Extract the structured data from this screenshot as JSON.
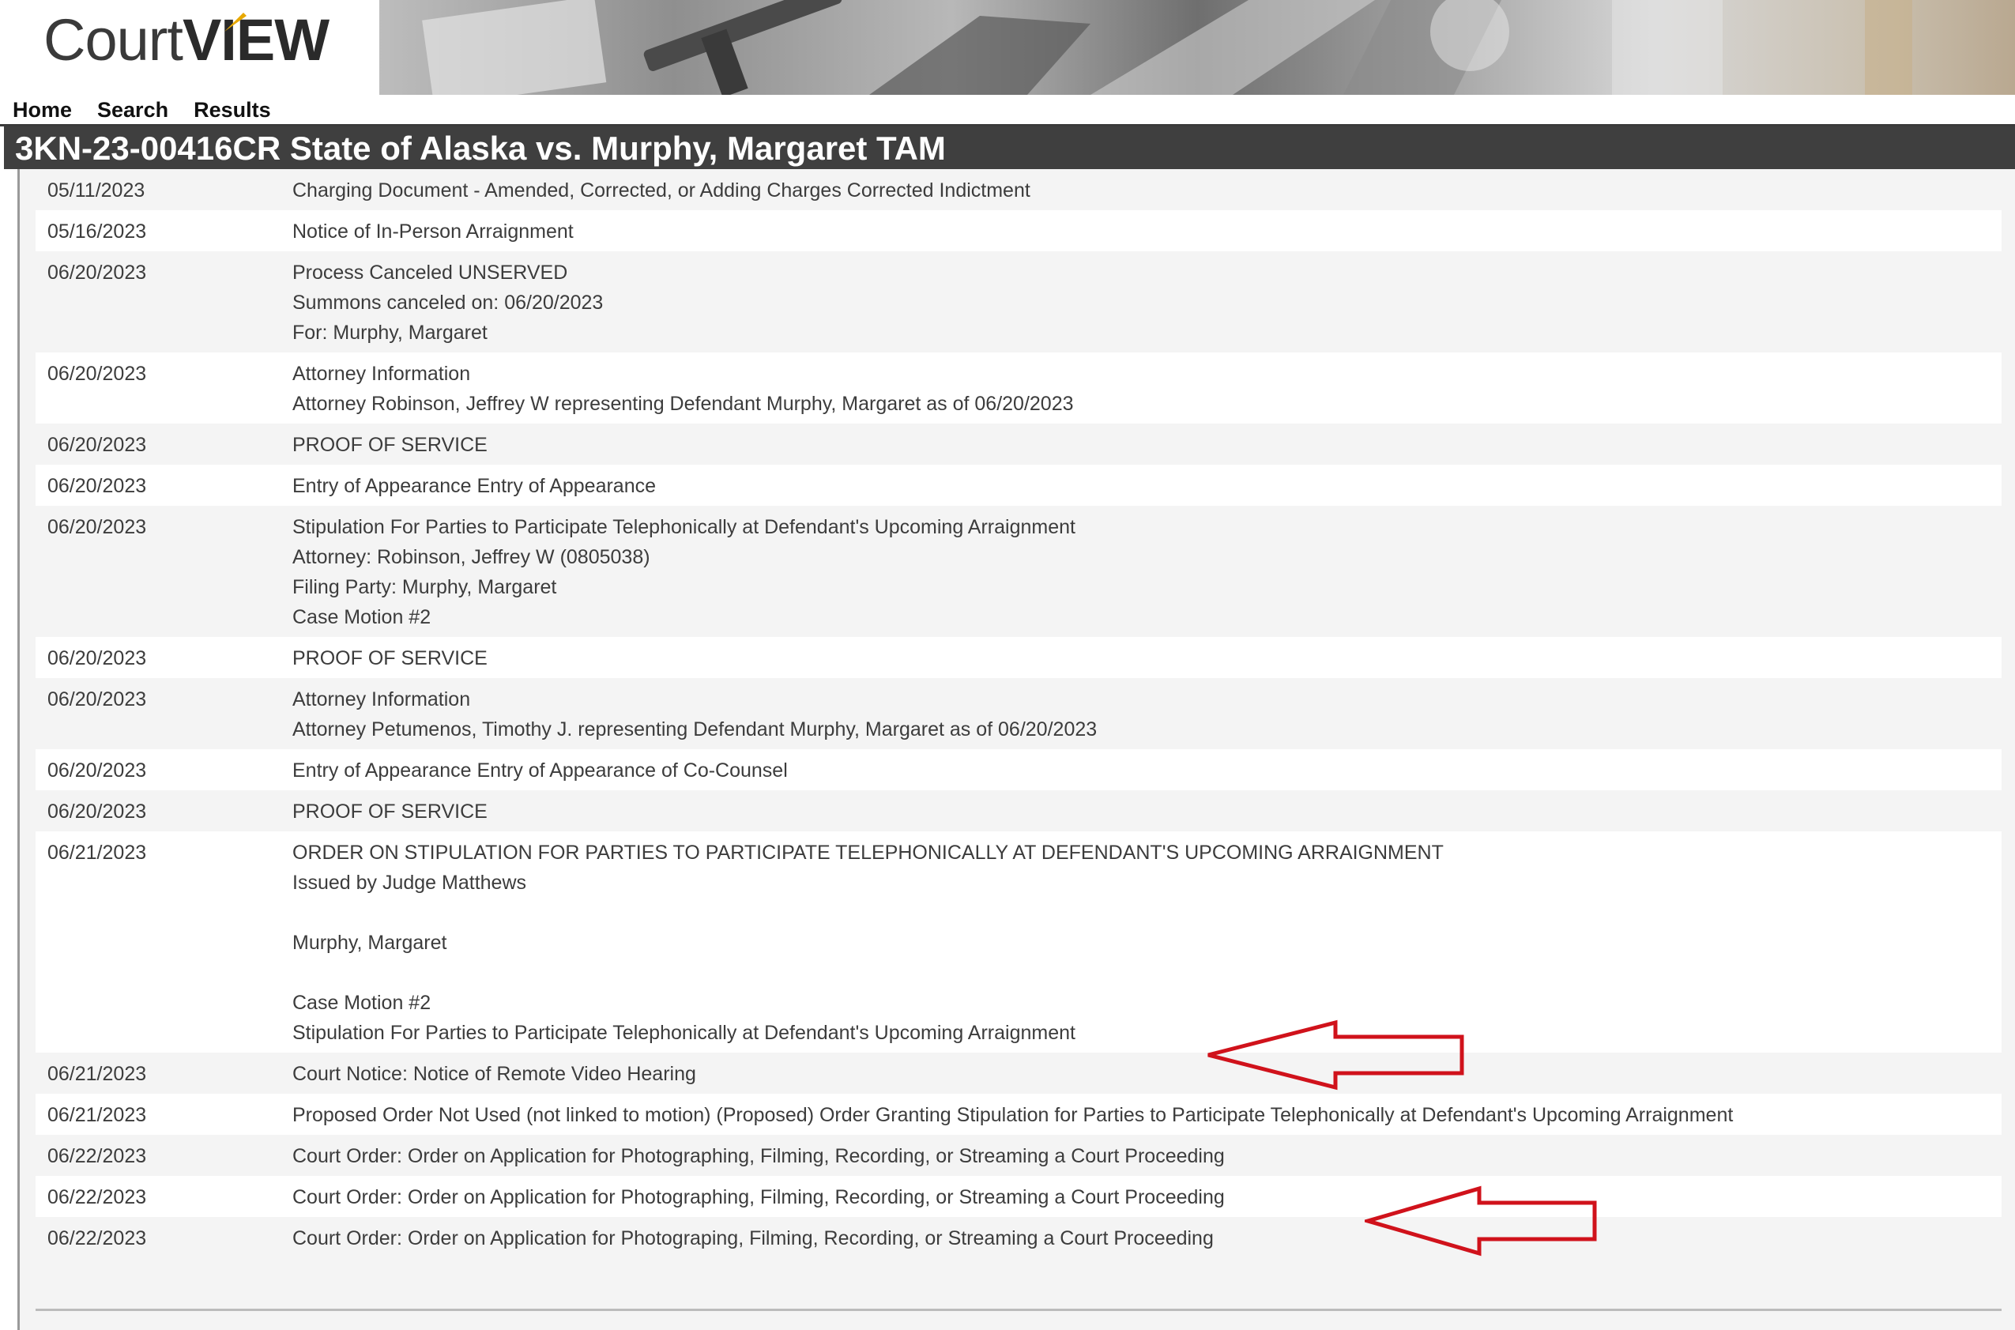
{
  "app": {
    "logo_text_court": "Court",
    "logo_text_view": "VIEW"
  },
  "nav": {
    "home": "Home",
    "search": "Search",
    "results": "Results"
  },
  "case": {
    "title": "3KN-23-00416CR State of Alaska vs. Murphy, Margaret TAM"
  },
  "annotations": {
    "arrow_color": "#d0121b"
  },
  "docket": [
    {
      "date": "05/11/2023",
      "description": "Charging Document - Amended, Corrected, or Adding Charges Corrected Indictment"
    },
    {
      "date": "05/16/2023",
      "description": "Notice of In-Person Arraignment"
    },
    {
      "date": "06/20/2023",
      "description": "Process Canceled UNSERVED\nSummons canceled on: 06/20/2023\nFor: Murphy, Margaret"
    },
    {
      "date": "06/20/2023",
      "description": "Attorney Information\nAttorney Robinson, Jeffrey W representing Defendant Murphy, Margaret as of 06/20/2023"
    },
    {
      "date": "06/20/2023",
      "description": "PROOF OF SERVICE"
    },
    {
      "date": "06/20/2023",
      "description": "Entry of Appearance Entry of Appearance"
    },
    {
      "date": "06/20/2023",
      "description": "Stipulation For Parties to Participate Telephonically at Defendant's Upcoming Arraignment\nAttorney: Robinson, Jeffrey W (0805038)\nFiling Party:  Murphy, Margaret\nCase Motion #2"
    },
    {
      "date": "06/20/2023",
      "description": "PROOF OF SERVICE"
    },
    {
      "date": "06/20/2023",
      "description": "Attorney Information\nAttorney Petumenos, Timothy J. representing Defendant Murphy, Margaret as of 06/20/2023"
    },
    {
      "date": "06/20/2023",
      "description": "Entry of Appearance Entry of Appearance of Co-Counsel"
    },
    {
      "date": "06/20/2023",
      "description": "PROOF OF SERVICE"
    },
    {
      "date": "06/21/2023",
      "description": "ORDER ON STIPULATION FOR PARTIES TO PARTICIPATE TELEPHONICALLY AT DEFENDANT'S UPCOMING ARRAIGNMENT\nIssued by Judge Matthews\n\n     Murphy, Margaret\n\nCase Motion #2\nStipulation For Parties to Participate Telephonically at Defendant's Upcoming Arraignment"
    },
    {
      "date": "06/21/2023",
      "description": "Court Notice: Notice of Remote Video Hearing"
    },
    {
      "date": "06/21/2023",
      "description": "Proposed Order Not Used (not linked to motion) (Proposed) Order Granting Stipulation for Parties to Participate Telephonically at Defendant's Upcoming Arraignment"
    },
    {
      "date": "06/22/2023",
      "description": "Court Order: Order on Application for Photographing, Filming, Recording, or Streaming a Court Proceeding"
    },
    {
      "date": "06/22/2023",
      "description": "Court Order: Order on Application for Photographing, Filming, Recording, or Streaming a Court Proceeding"
    },
    {
      "date": "06/22/2023",
      "description": "Court Order: Order on Application for Photograping, Filming, Recording, or Streaming a Court Proceeding"
    }
  ]
}
